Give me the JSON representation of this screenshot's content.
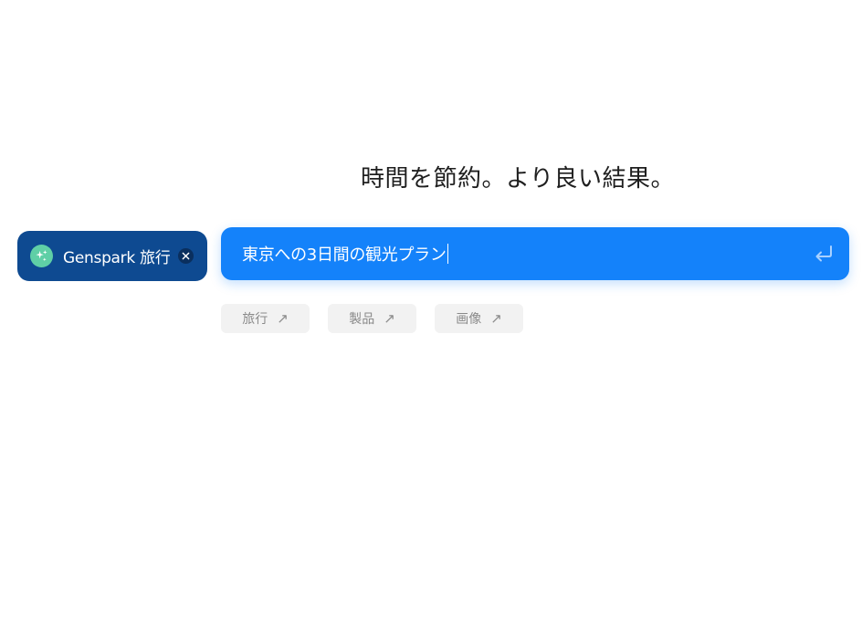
{
  "headline": "時間を節約。より良い結果。",
  "agent_chip": {
    "icon": "sparkle-icon",
    "label": "Genspark 旅行",
    "close_icon": "close-icon"
  },
  "search": {
    "value": "東京への3日間の観光プラン",
    "enter_icon": "enter-icon"
  },
  "suggestions": [
    {
      "label": "旅行",
      "icon": "arrow-up-right-icon"
    },
    {
      "label": "製品",
      "icon": "arrow-up-right-icon"
    },
    {
      "label": "画像",
      "icon": "arrow-up-right-icon"
    }
  ],
  "colors": {
    "search_bg": "#1482fa",
    "chip_bg": "#0e4a91",
    "chip_icon_bg": "#5fcfa6",
    "suggestion_bg": "#f2f2f2"
  }
}
